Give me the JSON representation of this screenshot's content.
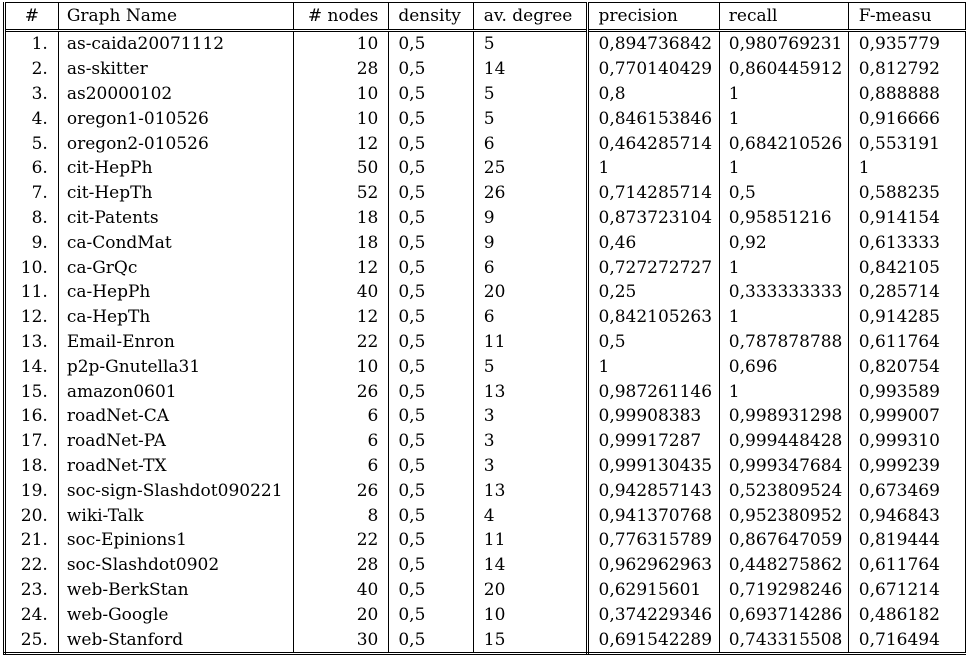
{
  "headers": [
    "#",
    "Graph Name",
    "# nodes",
    "density",
    "av. degree",
    "precision",
    "recall",
    "F-measu"
  ],
  "rows": [
    [
      "1.",
      "as-caida20071112",
      "10",
      "0,5",
      "5",
      "0,894736842",
      "0,980769231",
      "0,935779"
    ],
    [
      "2.",
      "as-skitter",
      "28",
      "0,5",
      "14",
      "0,770140429",
      "0,860445912",
      "0,812792"
    ],
    [
      "3.",
      "as20000102",
      "10",
      "0,5",
      "5",
      "0,8",
      "1",
      "0,888888"
    ],
    [
      "4.",
      "oregon1-010526",
      "10",
      "0,5",
      "5",
      "0,846153846",
      "1",
      "0,916666"
    ],
    [
      "5.",
      "oregon2-010526",
      "12",
      "0,5",
      "6",
      "0,464285714",
      "0,684210526",
      "0,553191"
    ],
    [
      "6.",
      "cit-HepPh",
      "50",
      "0,5",
      "25",
      "1",
      "1",
      "1"
    ],
    [
      "7.",
      "cit-HepTh",
      "52",
      "0,5",
      "26",
      "0,714285714",
      "0,5",
      "0,588235"
    ],
    [
      "8.",
      "cit-Patents",
      "18",
      "0,5",
      "9",
      "0,873723104",
      "0,95851216",
      "0,914154"
    ],
    [
      "9.",
      "ca-CondMat",
      "18",
      "0,5",
      "9",
      "0,46",
      "0,92",
      "0,613333"
    ],
    [
      "10.",
      "ca-GrQc",
      "12",
      "0,5",
      "6",
      "0,727272727",
      "1",
      "0,842105"
    ],
    [
      "11.",
      "ca-HepPh",
      "40",
      "0,5",
      "20",
      "0,25",
      "0,333333333",
      "0,285714"
    ],
    [
      "12.",
      "ca-HepTh",
      "12",
      "0,5",
      "6",
      "0,842105263",
      "1",
      "0,914285"
    ],
    [
      "13.",
      "Email-Enron",
      "22",
      "0,5",
      "11",
      "0,5",
      "0,787878788",
      "0,611764"
    ],
    [
      "14.",
      "p2p-Gnutella31",
      "10",
      "0,5",
      "5",
      "1",
      "0,696",
      "0,820754"
    ],
    [
      "15.",
      "amazon0601",
      "26",
      "0,5",
      "13",
      "0,987261146",
      "1",
      "0,993589"
    ],
    [
      "16.",
      "roadNet-CA",
      "6",
      "0,5",
      "3",
      "0,99908383",
      "0,998931298",
      "0,999007"
    ],
    [
      "17.",
      "roadNet-PA",
      "6",
      "0,5",
      "3",
      "0,99917287",
      "0,999448428",
      "0,999310"
    ],
    [
      "18.",
      "roadNet-TX",
      "6",
      "0,5",
      "3",
      "0,999130435",
      "0,999347684",
      "0,999239"
    ],
    [
      "19.",
      "soc-sign-Slashdot090221",
      "26",
      "0,5",
      "13",
      "0,942857143",
      "0,523809524",
      "0,673469"
    ],
    [
      "20.",
      "wiki-Talk",
      "8",
      "0,5",
      "4",
      "0,941370768",
      "0,952380952",
      "0,946843"
    ],
    [
      "21.",
      "soc-Epinions1",
      "22",
      "0,5",
      "11",
      "0,776315789",
      "0,867647059",
      "0,819444"
    ],
    [
      "22.",
      "soc-Slashdot0902",
      "28",
      "0,5",
      "14",
      "0,962962963",
      "0,448275862",
      "0,611764"
    ],
    [
      "23.",
      "web-BerkStan",
      "40",
      "0,5",
      "20",
      "0,62915601",
      "0,719298246",
      "0,671214"
    ],
    [
      "24.",
      "web-Google",
      "20",
      "0,5",
      "10",
      "0,374229346",
      "0,693714286",
      "0,486182"
    ],
    [
      "25.",
      "web-Stanford",
      "30",
      "0,5",
      "15",
      "0,691542289",
      "0,743315508",
      "0,716494"
    ]
  ]
}
